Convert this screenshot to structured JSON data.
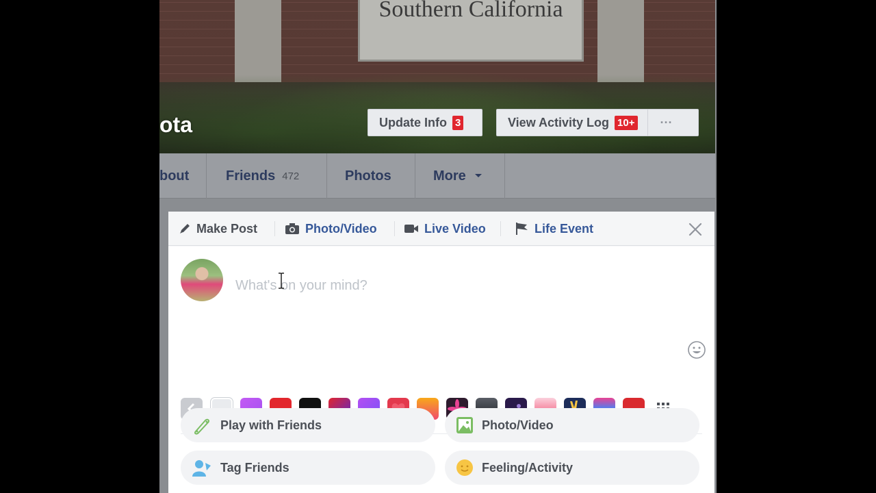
{
  "cover": {
    "sign_text": "Southern California",
    "name_partial": "ota",
    "update_info": {
      "label": "Update Info",
      "badge": "3"
    },
    "activity_log": {
      "label": "View Activity Log",
      "badge": "10+"
    },
    "more_label": "···"
  },
  "nav": {
    "about": "bout",
    "friends": "Friends",
    "friends_count": "472",
    "photos": "Photos",
    "more": "More"
  },
  "composer": {
    "tabs": {
      "make_post": "Make Post",
      "photo_video": "Photo/Video",
      "live_video": "Live Video",
      "life_event": "Life Event"
    },
    "placeholder": "What's on your mind?",
    "swatch_colors": [
      "#e9ebee",
      "#c35bf3",
      "#e2272d",
      "#111111",
      "#8a2d8c",
      "#8a52f7",
      "#e3394d",
      "#f36b25",
      "#3a1f3a",
      "#373a41",
      "#2a1a4a",
      "#f05a7a",
      "#1d2d5a",
      "#4c7ef2",
      "#d92a2f"
    ],
    "actions": {
      "play": "Play with Friends",
      "photo_video": "Photo/Video",
      "tag": "Tag Friends",
      "feeling": "Feeling/Activity"
    }
  },
  "colors": {
    "fb_blue": "#365899",
    "text_gray": "#4b4f56",
    "placeholder": "#bec3c9",
    "badge_red": "#e0262e"
  }
}
